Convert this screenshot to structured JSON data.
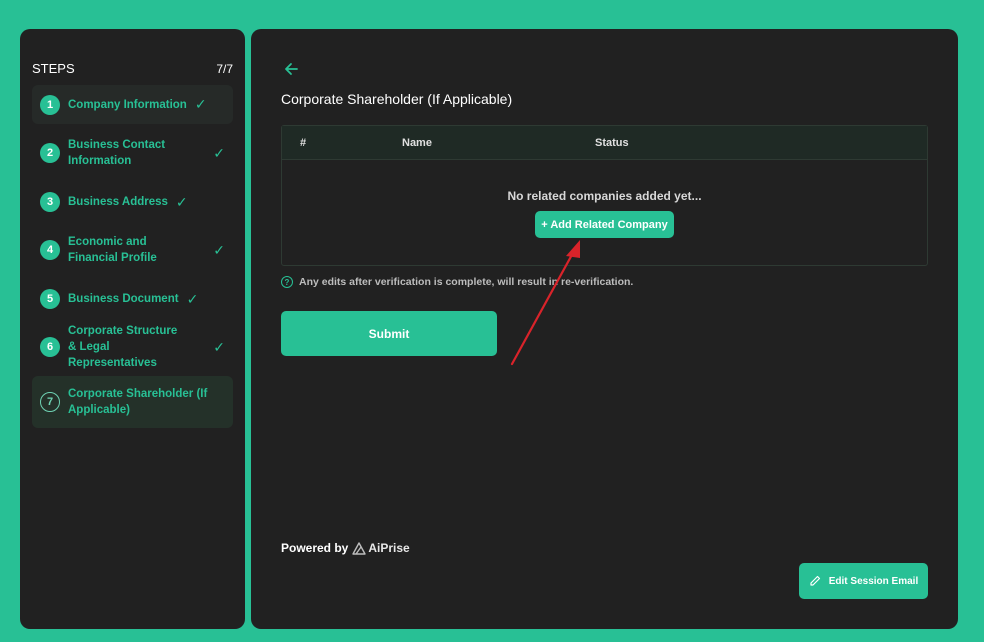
{
  "sidebar": {
    "title": "STEPS",
    "count": "7/7",
    "steps": [
      {
        "num": "1",
        "label": "Company Information",
        "status": "done"
      },
      {
        "num": "2",
        "label": "Business Contact Information",
        "status": "done"
      },
      {
        "num": "3",
        "label": "Business Address",
        "status": "done"
      },
      {
        "num": "4",
        "label": "Economic and Financial Profile",
        "status": "done"
      },
      {
        "num": "5",
        "label": "Business Document",
        "status": "done"
      },
      {
        "num": "6",
        "label": "Corporate Structure & Legal Representatives",
        "status": "done"
      },
      {
        "num": "7",
        "label": "Corporate Shareholder (If Applicable)",
        "status": "active"
      }
    ]
  },
  "main": {
    "back_icon": "arrow-left-icon",
    "title": "Corporate Shareholder (If Applicable)",
    "table": {
      "columns": [
        "#",
        "Name",
        "Status"
      ],
      "empty_message": "No related companies added yet...",
      "add_label": "+ Add Related Company"
    },
    "notice": "Any edits after verification is complete, will result in re-verification.",
    "submit_label": "Submit",
    "powered_by": "Powered by",
    "brand": "AiPrise",
    "edit_session_label": "Edit Session Email"
  },
  "colors": {
    "background": "#28c095",
    "panel": "#212121",
    "accent": "#28c095",
    "annotation_arrow": "#d9232a"
  }
}
